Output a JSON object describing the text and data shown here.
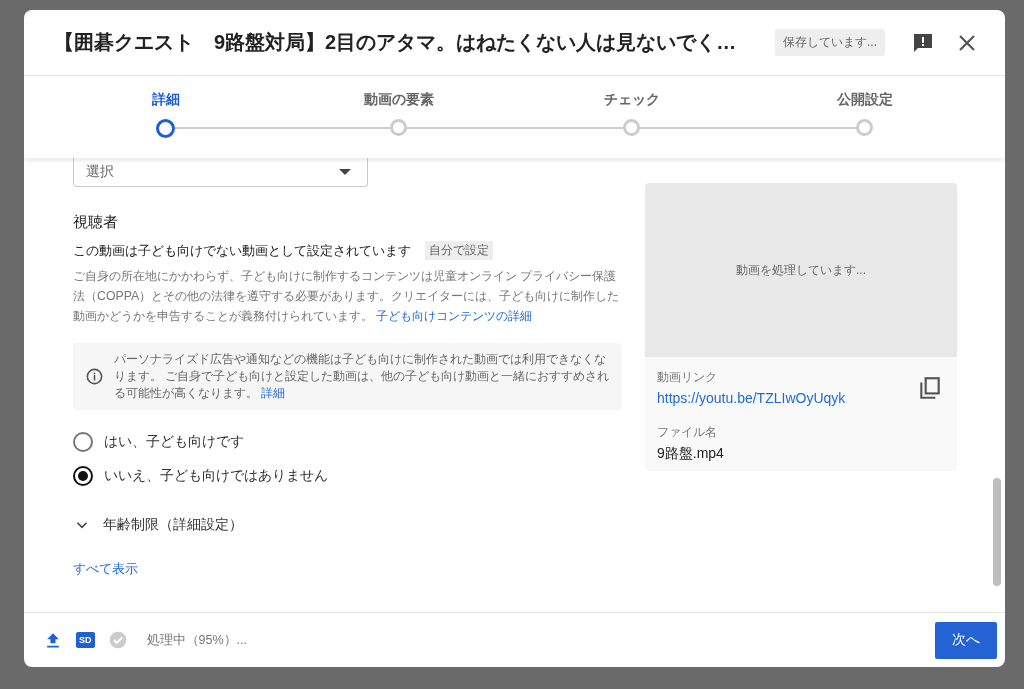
{
  "dialog": {
    "title": "【囲碁クエスト　9路盤対局】2目のアタマ。はねたくない人は見ないでく…",
    "save_status": "保存しています...",
    "steps": [
      {
        "label": "詳細",
        "selected": true
      },
      {
        "label": "動画の要素",
        "selected": false
      },
      {
        "label": "チェック",
        "selected": false
      },
      {
        "label": "公開設定",
        "selected": false
      }
    ]
  },
  "details": {
    "select_field": {
      "value": "選択"
    },
    "audience": {
      "heading": "視聴者",
      "status": "この動画は子ども向けでない動画として設定されています",
      "status_tag": "自分で設定",
      "description": "ご自身の所在地にかかわらず、子ども向けに制作するコンテンツは児童オンライン プライバシー保護法（COPPA）とその他の法律を遵守する必要があります。クリエイターには、子ども向けに制作した動画かどうかを申告することが義務付けられています。",
      "description_link": "子ども向けコンテンツの詳細",
      "notice": "パーソナライズド広告や通知などの機能は子ども向けに制作された動画では利用できなくなります。 ご自身で子ども向けと設定した動画は、他の子ども向け動画と一緒におすすめされる可能性が高くなります。",
      "notice_link": "詳細",
      "options": [
        {
          "label": "はい、子ども向けです",
          "selected": false
        },
        {
          "label": "いいえ、子ども向けではありません",
          "selected": true
        }
      ]
    },
    "age_restriction": {
      "label": "年齢制限（詳細設定）",
      "expanded": false
    },
    "show_all": "すべて表示"
  },
  "preview": {
    "message": "動画を処理しています...",
    "link_label": "動画リンク",
    "link": "https://youtu.be/TZLIwOyUqyk",
    "file_label": "ファイル名",
    "file_name": "9路盤.mp4"
  },
  "footer": {
    "badge": "SD",
    "status": "処理中（95%）...",
    "next_button": "次へ"
  }
}
